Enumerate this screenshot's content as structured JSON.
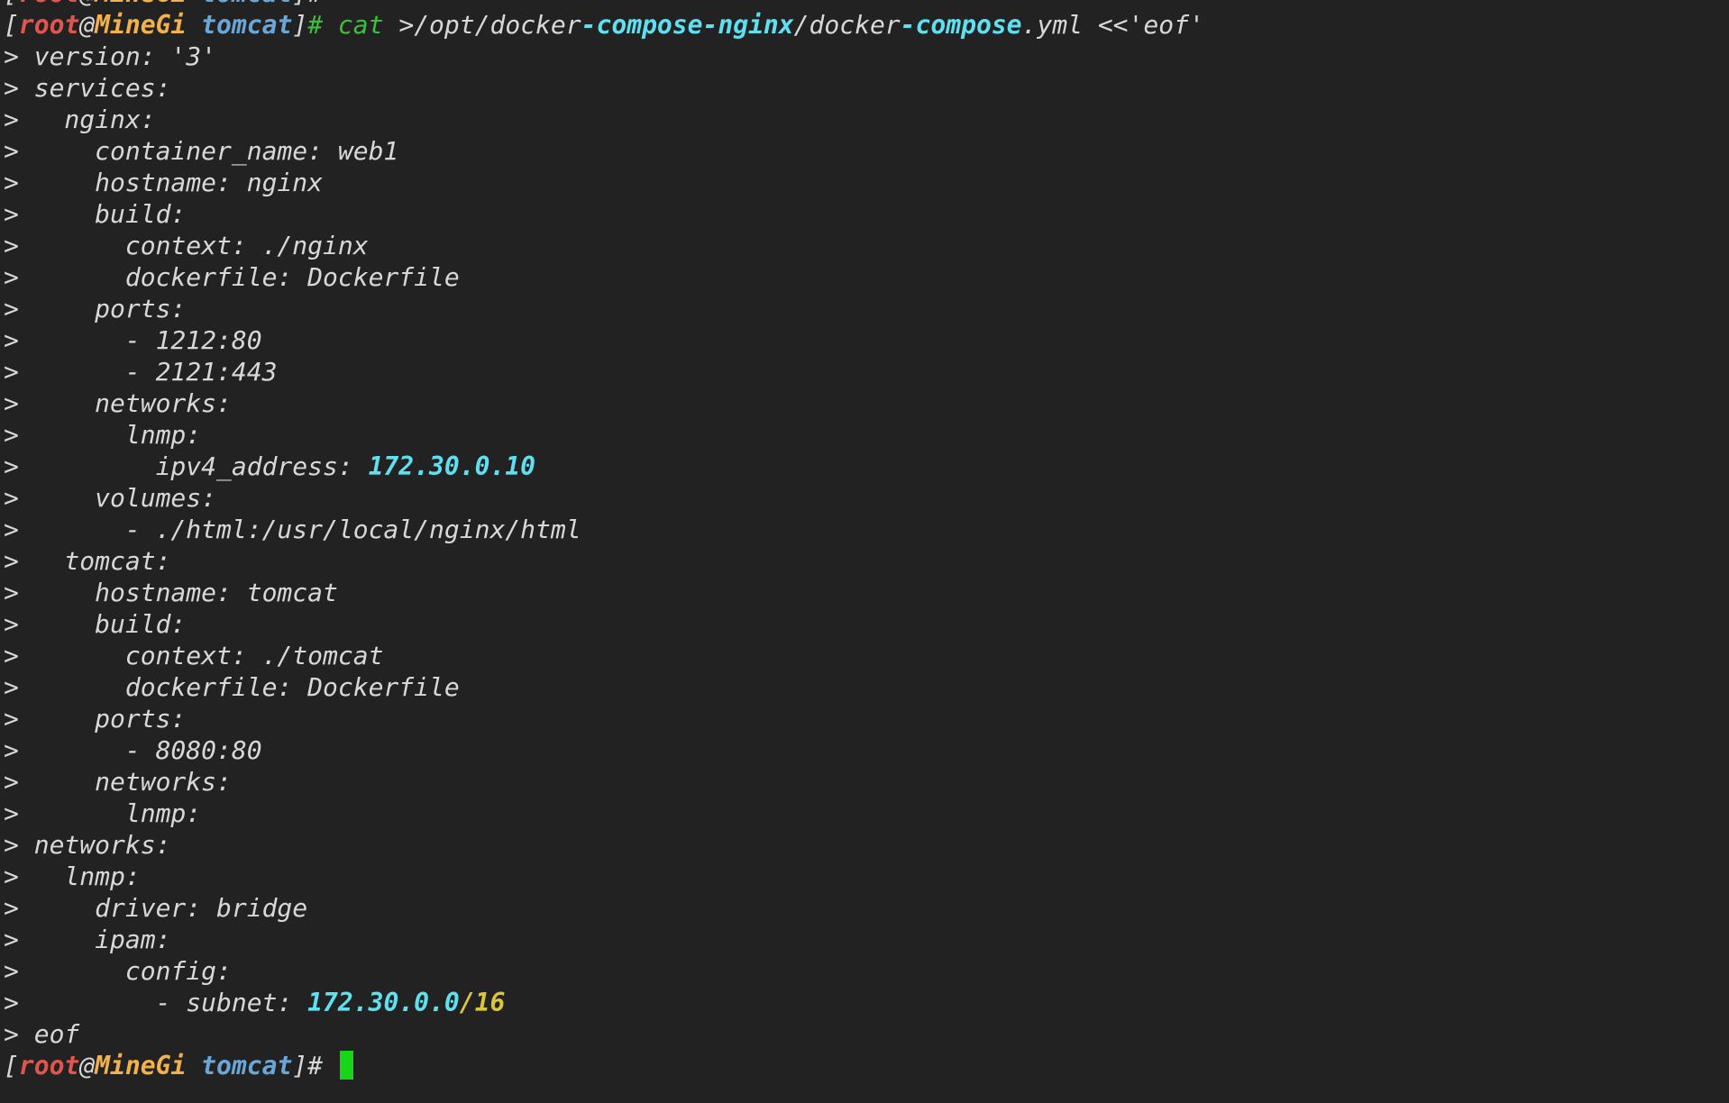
{
  "colors": {
    "background": "#222222",
    "default": "#d8d8d8",
    "bracket": "#d8d8d8",
    "user": "#e0554f",
    "host": "#f2b14a",
    "path": "#6aa7d8",
    "command": "#3cc03c",
    "cyan": "#5fe0f0",
    "yellow": "#d9c63c",
    "cursor": "#17d617"
  },
  "terminal": {
    "prompt": {
      "open": "[",
      "user": "root",
      "at": "@",
      "host": "MineGi",
      "space": " ",
      "dir": "tomcat",
      "close": "]",
      "symbol": "# "
    },
    "partial_top": {
      "segments": [
        {
          "text": "[",
          "color": "bracket"
        },
        {
          "text": "root",
          "color": "user",
          "bold": true
        },
        {
          "text": "@",
          "color": "bracket"
        },
        {
          "text": "MineGi",
          "color": "host",
          "bold": true
        },
        {
          "text": " ",
          "color": "default"
        },
        {
          "text": "tomcat",
          "color": "path",
          "bold": true
        },
        {
          "text": "]# ",
          "color": "bracket"
        }
      ]
    },
    "lines": [
      {
        "segments": [
          {
            "text": "[",
            "color": "bracket"
          },
          {
            "text": "root",
            "color": "user",
            "bold": true
          },
          {
            "text": "@",
            "color": "bracket"
          },
          {
            "text": "MineGi",
            "color": "host",
            "bold": true
          },
          {
            "text": " ",
            "color": "default"
          },
          {
            "text": "tomcat",
            "color": "path",
            "bold": true
          },
          {
            "text": "]",
            "color": "bracket"
          },
          {
            "text": "# ",
            "color": "command"
          },
          {
            "text": "cat",
            "color": "command"
          },
          {
            "text": " >/opt/docker",
            "color": "default"
          },
          {
            "text": "-compose-nginx",
            "color": "cyan",
            "bold": true
          },
          {
            "text": "/docker",
            "color": "default"
          },
          {
            "text": "-compose",
            "color": "cyan",
            "bold": true
          },
          {
            "text": ".yml <<'eof'",
            "color": "default"
          }
        ]
      },
      {
        "segments": [
          {
            "text": "> version: '3'",
            "color": "default"
          }
        ]
      },
      {
        "segments": [
          {
            "text": "> services:",
            "color": "default"
          }
        ]
      },
      {
        "segments": [
          {
            "text": ">   nginx:",
            "color": "default"
          }
        ]
      },
      {
        "segments": [
          {
            "text": ">     container_name: web1",
            "color": "default"
          }
        ]
      },
      {
        "segments": [
          {
            "text": ">     hostname: nginx",
            "color": "default"
          }
        ]
      },
      {
        "segments": [
          {
            "text": ">     build:",
            "color": "default"
          }
        ]
      },
      {
        "segments": [
          {
            "text": ">       context: ./nginx",
            "color": "default"
          }
        ]
      },
      {
        "segments": [
          {
            "text": ">       dockerfile: Dockerfile",
            "color": "default"
          }
        ]
      },
      {
        "segments": [
          {
            "text": ">     ports:",
            "color": "default"
          }
        ]
      },
      {
        "segments": [
          {
            "text": ">       - 1212:80",
            "color": "default"
          }
        ]
      },
      {
        "segments": [
          {
            "text": ">       - 2121:443",
            "color": "default"
          }
        ]
      },
      {
        "segments": [
          {
            "text": ">     networks:",
            "color": "default"
          }
        ]
      },
      {
        "segments": [
          {
            "text": ">       lnmp:",
            "color": "default"
          }
        ]
      },
      {
        "segments": [
          {
            "text": ">         ipv4_address: ",
            "color": "default"
          },
          {
            "text": "172.30.0.10",
            "color": "cyan",
            "bold": true
          }
        ]
      },
      {
        "segments": [
          {
            "text": ">     volumes:",
            "color": "default"
          }
        ]
      },
      {
        "segments": [
          {
            "text": ">       - ./html:/usr/local/nginx/html",
            "color": "default"
          }
        ]
      },
      {
        "segments": [
          {
            "text": ">   tomcat:",
            "color": "default"
          }
        ]
      },
      {
        "segments": [
          {
            "text": ">     hostname: tomcat",
            "color": "default"
          }
        ]
      },
      {
        "segments": [
          {
            "text": ">     build:",
            "color": "default"
          }
        ]
      },
      {
        "segments": [
          {
            "text": ">       context: ./tomcat",
            "color": "default"
          }
        ]
      },
      {
        "segments": [
          {
            "text": ">       dockerfile: Dockerfile",
            "color": "default"
          }
        ]
      },
      {
        "segments": [
          {
            "text": ">     ports:",
            "color": "default"
          }
        ]
      },
      {
        "segments": [
          {
            "text": ">       - 8080:80",
            "color": "default"
          }
        ]
      },
      {
        "segments": [
          {
            "text": ">     networks:",
            "color": "default"
          }
        ]
      },
      {
        "segments": [
          {
            "text": ">       lnmp:",
            "color": "default"
          }
        ]
      },
      {
        "segments": [
          {
            "text": "> networks:",
            "color": "default"
          }
        ]
      },
      {
        "segments": [
          {
            "text": ">   lnmp:",
            "color": "default"
          }
        ]
      },
      {
        "segments": [
          {
            "text": ">     driver: bridge",
            "color": "default"
          }
        ]
      },
      {
        "segments": [
          {
            "text": ">     ipam:",
            "color": "default"
          }
        ]
      },
      {
        "segments": [
          {
            "text": ">       config:",
            "color": "default"
          }
        ]
      },
      {
        "segments": [
          {
            "text": ">         - subnet: ",
            "color": "default"
          },
          {
            "text": "172.30.0.0",
            "color": "cyan",
            "bold": true
          },
          {
            "text": "/16",
            "color": "yellow",
            "bold": true
          }
        ]
      },
      {
        "segments": [
          {
            "text": "> eof",
            "color": "default"
          }
        ]
      },
      {
        "segments": [
          {
            "text": "[",
            "color": "bracket"
          },
          {
            "text": "root",
            "color": "user",
            "bold": true
          },
          {
            "text": "@",
            "color": "bracket"
          },
          {
            "text": "MineGi",
            "color": "host",
            "bold": true
          },
          {
            "text": " ",
            "color": "default"
          },
          {
            "text": "tomcat",
            "color": "path",
            "bold": true
          },
          {
            "text": "]# ",
            "color": "bracket"
          }
        ],
        "cursor": true
      }
    ]
  }
}
